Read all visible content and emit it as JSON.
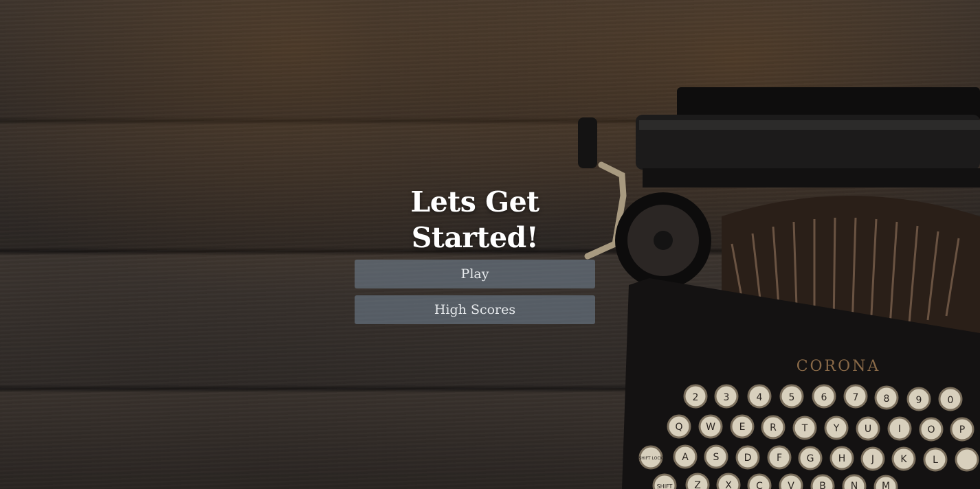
{
  "title": "Lets Get Started!",
  "buttons": {
    "play_label": "Play",
    "high_scores_label": "High Scores"
  },
  "typewriter": {
    "brand": "CORONA",
    "row1": [
      "2",
      "3",
      "4",
      "5",
      "6",
      "7",
      "8",
      "9",
      "0"
    ],
    "row2": [
      "Q",
      "W",
      "E",
      "R",
      "T",
      "Y",
      "U",
      "I",
      "O",
      "P"
    ],
    "row3": [
      "SHIFT LOCK",
      "A",
      "S",
      "D",
      "F",
      "G",
      "H",
      "J",
      "K",
      "L"
    ],
    "row4": [
      "SHIFT",
      "Z",
      "X",
      "C",
      "V",
      "B",
      "N",
      "M"
    ]
  },
  "colors": {
    "button_bg": "#7a8ca0",
    "title_text": "#ffffff",
    "button_text": "#e6e9ec"
  }
}
